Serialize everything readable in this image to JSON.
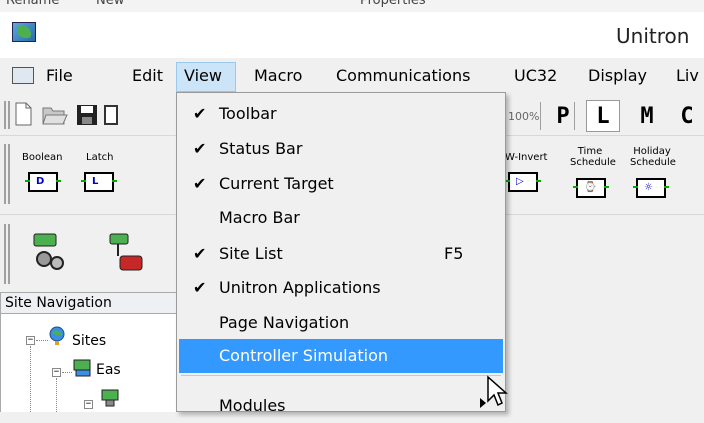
{
  "window": {
    "title": "Unitron"
  },
  "top_strip": {
    "text_1": "Rename",
    "text_2": "New",
    "text_3": "Properties"
  },
  "menubar": {
    "items": [
      "File",
      "Edit",
      "View",
      "Macro",
      "Communications",
      "UC32",
      "Display",
      "Liv"
    ]
  },
  "toolbar": {
    "zoom_label": "100%",
    "letters": [
      "P",
      "L",
      "M",
      "C"
    ]
  },
  "plc_blocks": {
    "boolean": "Boolean",
    "latch": "Latch",
    "w_invert": "W-Invert",
    "time_schedule": "Time Schedule",
    "holiday_schedule": "Holiday Schedule"
  },
  "site_navigation": {
    "title": "Site Navigation",
    "tree": [
      {
        "label": "Sites"
      },
      {
        "label": "Eas"
      }
    ]
  },
  "view_menu": {
    "items": [
      {
        "label": "Toolbar",
        "checked": true,
        "shortcut": ""
      },
      {
        "label": "Status Bar",
        "checked": true,
        "shortcut": ""
      },
      {
        "label": "Current Target",
        "checked": true,
        "shortcut": ""
      },
      {
        "label": "Macro Bar",
        "checked": false,
        "shortcut": ""
      },
      {
        "label": "Site List",
        "checked": true,
        "shortcut": "F5"
      },
      {
        "label": "Unitron Applications",
        "checked": true,
        "shortcut": ""
      },
      {
        "label": "Page Navigation",
        "checked": false,
        "shortcut": ""
      },
      {
        "label": "Controller Simulation",
        "checked": false,
        "shortcut": "",
        "highlighted": true
      },
      {
        "label": "Modules",
        "checked": false,
        "shortcut": "",
        "submenu": true
      }
    ],
    "check_glyph": "✔"
  },
  "colors": {
    "highlight": "#3399ff",
    "menu_bg": "#f0f0f0",
    "view_hover": "#cce4f7"
  }
}
